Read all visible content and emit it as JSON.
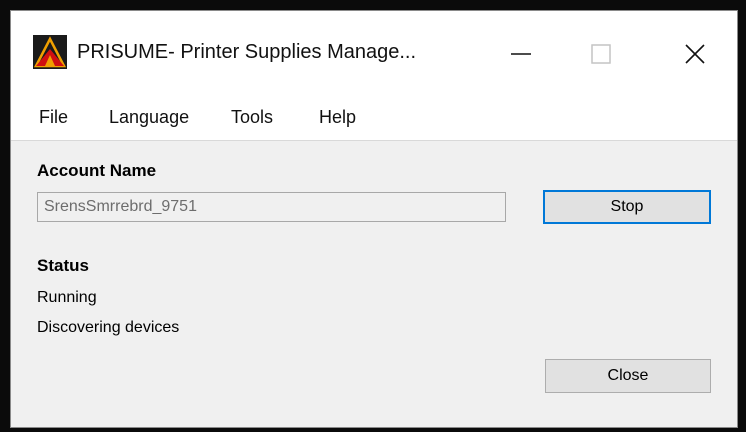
{
  "window": {
    "title": "PRISUME- Printer Supplies Manage..."
  },
  "menu": {
    "items": [
      "File",
      "Language",
      "Tools",
      "Help"
    ]
  },
  "account": {
    "label": "Account Name",
    "value": "SrensSmrrebrd_9751"
  },
  "status": {
    "label": "Status",
    "lines": [
      "Running",
      "Discovering devices"
    ]
  },
  "buttons": {
    "stop": "Stop",
    "close": "Close"
  },
  "colors": {
    "focus_border": "#0078d7",
    "icon_primary": "#f0a000",
    "icon_secondary": "#d01010"
  },
  "icons": {
    "app": "prisume-logo-icon",
    "minimize": "minimize-icon",
    "maximize": "maximize-icon",
    "close": "close-icon"
  }
}
